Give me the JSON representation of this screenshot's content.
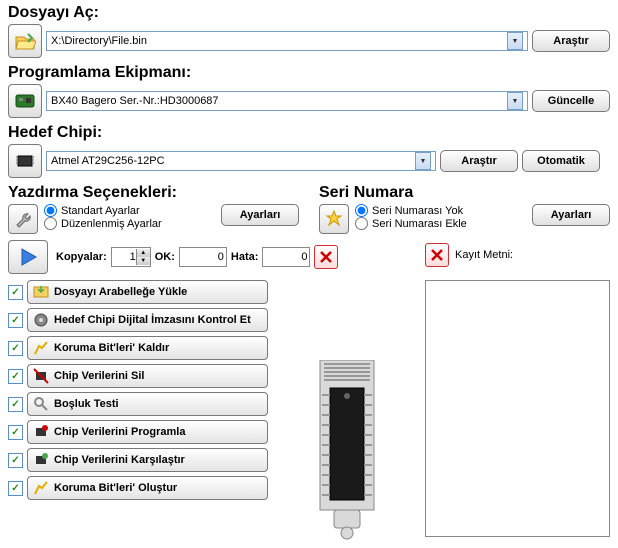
{
  "open_file": {
    "title": "Dosyayı Aç:",
    "value": "X:\\Directory\\File.bin",
    "browse": "Araştır"
  },
  "prog_equip": {
    "title": "Programlama Ekipmanı:",
    "value": "BX40 Bagero Ser.-Nr.:HD3000687",
    "update": "Güncelle"
  },
  "target_chip": {
    "title": "Hedef Chipi:",
    "value": "Atmel AT29C256-12PC",
    "browse": "Araştır",
    "auto": "Otomatik"
  },
  "print_opts": {
    "title": "Yazdırma Seçenekleri:",
    "opt1": "Standart Ayarlar",
    "opt2": "Düzenlenmiş Ayarlar",
    "settings": "Ayarları"
  },
  "serial": {
    "title": "Seri Numara",
    "opt1": "Seri Numarası Yok",
    "opt2": "Seri Numarası Ekle",
    "settings": "Ayarları"
  },
  "runbar": {
    "copies": "Kopyalar:",
    "copies_val": "1",
    "ok": "OK:",
    "ok_val": "0",
    "err": "Hata:",
    "err_val": "0"
  },
  "steps": [
    "Dosyayı Arabelleğe Yükle",
    "Hedef Chipi Dijital İmzasını Kontrol Et",
    "Koruma Bit'leri' Kaldır",
    "Chip Verilerini Sil",
    "Boşluk Testi",
    "Chip Verilerini Programla",
    "Chip Verilerini Karşılaştır",
    "Koruma Bit'leri' Oluştur"
  ],
  "log_title": "Kayıt Metni:"
}
